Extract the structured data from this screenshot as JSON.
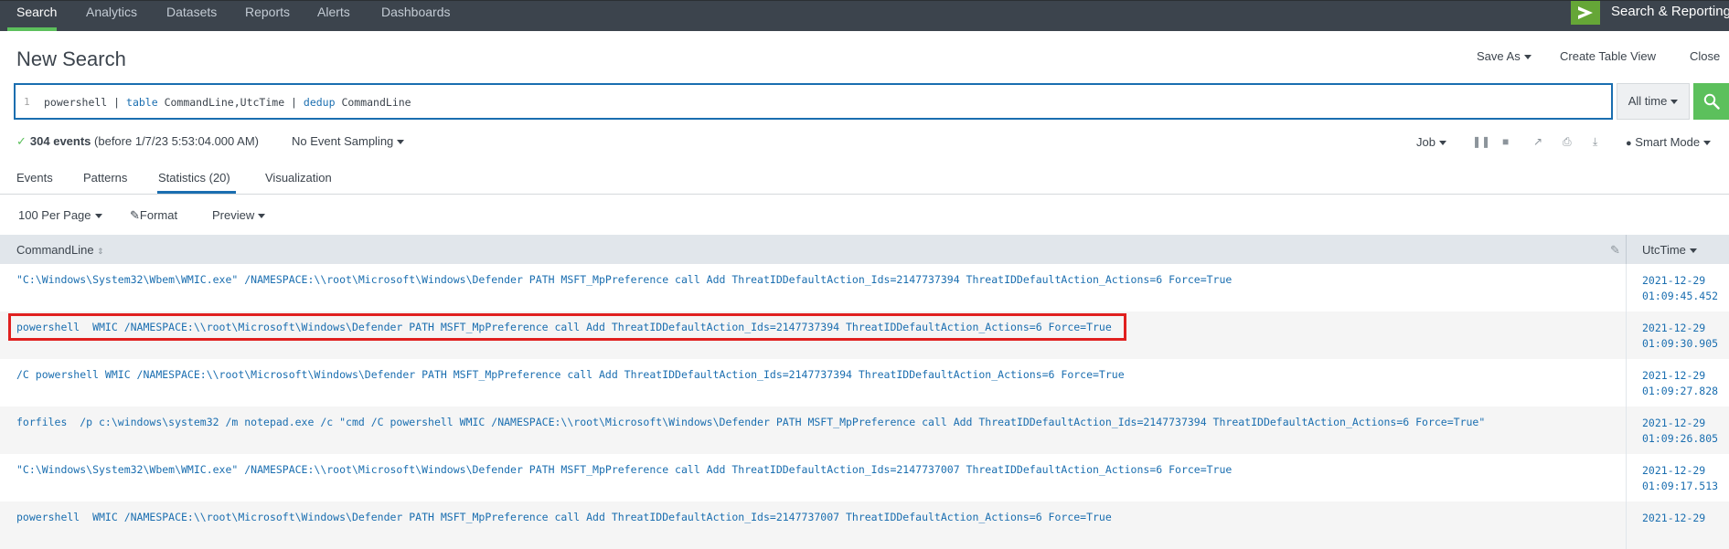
{
  "nav": {
    "items": [
      "Search",
      "Analytics",
      "Datasets",
      "Reports",
      "Alerts",
      "Dashboards"
    ],
    "active": "Search",
    "app_name": "Search & Reporting"
  },
  "page": {
    "title": "New Search",
    "save_as": "Save As",
    "create_table_view": "Create Table View",
    "close": "Close"
  },
  "search": {
    "line_number": "1",
    "query_parts": [
      {
        "t": "powershell | ",
        "kw": false
      },
      {
        "t": "table",
        "kw": true
      },
      {
        "t": " CommandLine,UtcTime | ",
        "kw": false
      },
      {
        "t": "dedup",
        "kw": true
      },
      {
        "t": " CommandLine",
        "kw": false
      }
    ],
    "time_range": "All time"
  },
  "status": {
    "events": "304 events",
    "before": "(before 1/7/23 5:53:04.000 AM)",
    "sampling": "No Event Sampling",
    "job": "Job",
    "mode": "Smart Mode"
  },
  "tabs": [
    "Events",
    "Patterns",
    "Statistics (20)",
    "Visualization"
  ],
  "toolbar": {
    "per_page": "100 Per Page",
    "format": "Format",
    "preview": "Preview"
  },
  "table": {
    "columns": [
      "CommandLine",
      "UtcTime"
    ],
    "rows": [
      {
        "cmd": "\"C:\\Windows\\System32\\Wbem\\WMIC.exe\" /NAMESPACE:\\\\root\\Microsoft\\Windows\\Defender PATH MSFT_MpPreference call Add ThreatIDDefaultAction_Ids=2147737394 ThreatIDDefaultAction_Actions=6 Force=True",
        "date": "2021-12-29",
        "time": "01:09:45.452"
      },
      {
        "cmd": "powershell  WMIC /NAMESPACE:\\\\root\\Microsoft\\Windows\\Defender PATH MSFT_MpPreference call Add ThreatIDDefaultAction_Ids=2147737394 ThreatIDDefaultAction_Actions=6 Force=True",
        "date": "2021-12-29",
        "time": "01:09:30.905"
      },
      {
        "cmd": "/C powershell WMIC /NAMESPACE:\\\\root\\Microsoft\\Windows\\Defender PATH MSFT_MpPreference call Add ThreatIDDefaultAction_Ids=2147737394 ThreatIDDefaultAction_Actions=6 Force=True",
        "date": "2021-12-29",
        "time": "01:09:27.828"
      },
      {
        "cmd": "forfiles  /p c:\\windows\\system32 /m notepad.exe /c \"cmd /C powershell WMIC /NAMESPACE:\\\\root\\Microsoft\\Windows\\Defender PATH MSFT_MpPreference call Add ThreatIDDefaultAction_Ids=2147737394 ThreatIDDefaultAction_Actions=6 Force=True\"",
        "date": "2021-12-29",
        "time": "01:09:26.805"
      },
      {
        "cmd": "\"C:\\Windows\\System32\\Wbem\\WMIC.exe\" /NAMESPACE:\\\\root\\Microsoft\\Windows\\Defender PATH MSFT_MpPreference call Add ThreatIDDefaultAction_Ids=2147737007 ThreatIDDefaultAction_Actions=6 Force=True",
        "date": "2021-12-29",
        "time": "01:09:17.513"
      },
      {
        "cmd": "powershell  WMIC /NAMESPACE:\\\\root\\Microsoft\\Windows\\Defender PATH MSFT_MpPreference call Add ThreatIDDefaultAction_Ids=2147737007 ThreatIDDefaultAction_Actions=6 Force=True",
        "date": "2021-12-29",
        "time": ""
      }
    ]
  },
  "colors": {
    "accent": "#1a6eb0",
    "topbar": "#3c444d",
    "green": "#5cc05c",
    "highlight": "#e0201f"
  }
}
